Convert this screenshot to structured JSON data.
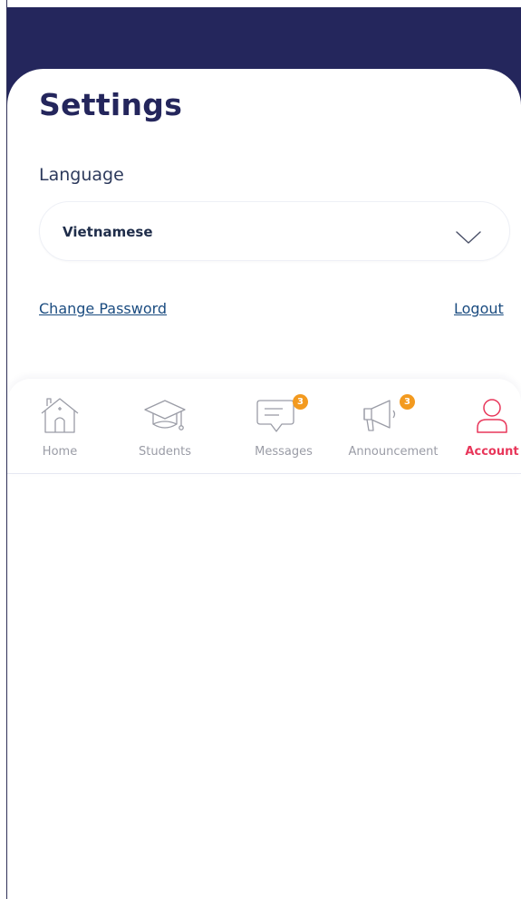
{
  "colors": {
    "header": "#24265c",
    "title": "#24265c",
    "link": "#1b4c80",
    "active_tab": "#e8365a",
    "inactive_tab": "#9a9ca6",
    "badge": "#f39a1f"
  },
  "page": {
    "title": "Settings"
  },
  "language": {
    "label": "Language",
    "selected": "Vietnamese",
    "chevron_icon": "chevron-down-icon"
  },
  "links": {
    "change_password": "Change Password",
    "logout": "Logout"
  },
  "tabs": [
    {
      "label": "Home",
      "icon": "home-icon",
      "badge": null,
      "active": false
    },
    {
      "label": "Students",
      "icon": "graduation-cap-icon",
      "badge": null,
      "active": false
    },
    {
      "label": "Messages",
      "icon": "message-icon",
      "badge": "3",
      "active": false
    },
    {
      "label": "Announcement",
      "icon": "megaphone-icon",
      "badge": "3",
      "active": false
    },
    {
      "label": "Account",
      "icon": "user-icon",
      "badge": null,
      "active": true
    }
  ]
}
